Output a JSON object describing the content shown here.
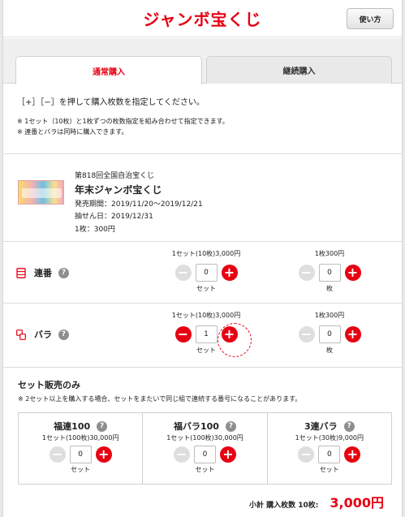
{
  "header": {
    "title": "ジャンボ宝くじ",
    "help_button": "使い方"
  },
  "tabs": [
    {
      "label": "通常購入",
      "active": true
    },
    {
      "label": "継続購入",
      "active": false
    }
  ],
  "notes": {
    "main": "［+］［−］を押して購入枚数を指定してください。",
    "sub1": "※ 1セット（10枚）と1枚ずつの枚数指定を組み合わせて指定できます。",
    "sub2": "※ 連番とバラは同時に購入できます。"
  },
  "lottery": {
    "round": "第818回全国自治宝くじ",
    "name": "年末ジャンボ宝くじ",
    "period": "発売期間：2019/11/20〜2019/12/21",
    "draw_date": "抽せん日：2019/12/31",
    "price": "1枚：300円"
  },
  "rows": {
    "renban": {
      "label": "連番",
      "set": {
        "price": "1セット(10枚)3,000円",
        "value": "0",
        "unit": "セット"
      },
      "single": {
        "price": "1枚300円",
        "value": "0",
        "unit": "枚"
      }
    },
    "bara": {
      "label": "バラ",
      "set": {
        "price": "1セット(10枚)3,000円",
        "value": "1",
        "unit": "セット"
      },
      "single": {
        "price": "1枚300円",
        "value": "0",
        "unit": "枚"
      }
    }
  },
  "set_only": {
    "title": "セット販売のみ",
    "note": "※ 2セット以上を購入する場合、セットをまたいで同じ組で連続する番号になることがあります。",
    "items": [
      {
        "name": "福連100",
        "price": "1セット(100枚)30,000円",
        "value": "0",
        "unit": "セット"
      },
      {
        "name": "福バラ100",
        "price": "1セット(100枚)30,000円",
        "value": "0",
        "unit": "セット"
      },
      {
        "name": "3連バラ",
        "price": "1セット(30枚)9,000円",
        "value": "0",
        "unit": "セット"
      }
    ]
  },
  "summary": {
    "label": "小計 購入枚数 10枚:",
    "amount": "3,000円"
  },
  "symbols": {
    "plus": "+",
    "minus": "−",
    "help": "?"
  },
  "colors": {
    "accent": "#e60012",
    "disabled": "#dedede"
  },
  "icons": {
    "renban": "renban-icon",
    "bara": "bara-icon",
    "help": "question-icon"
  }
}
